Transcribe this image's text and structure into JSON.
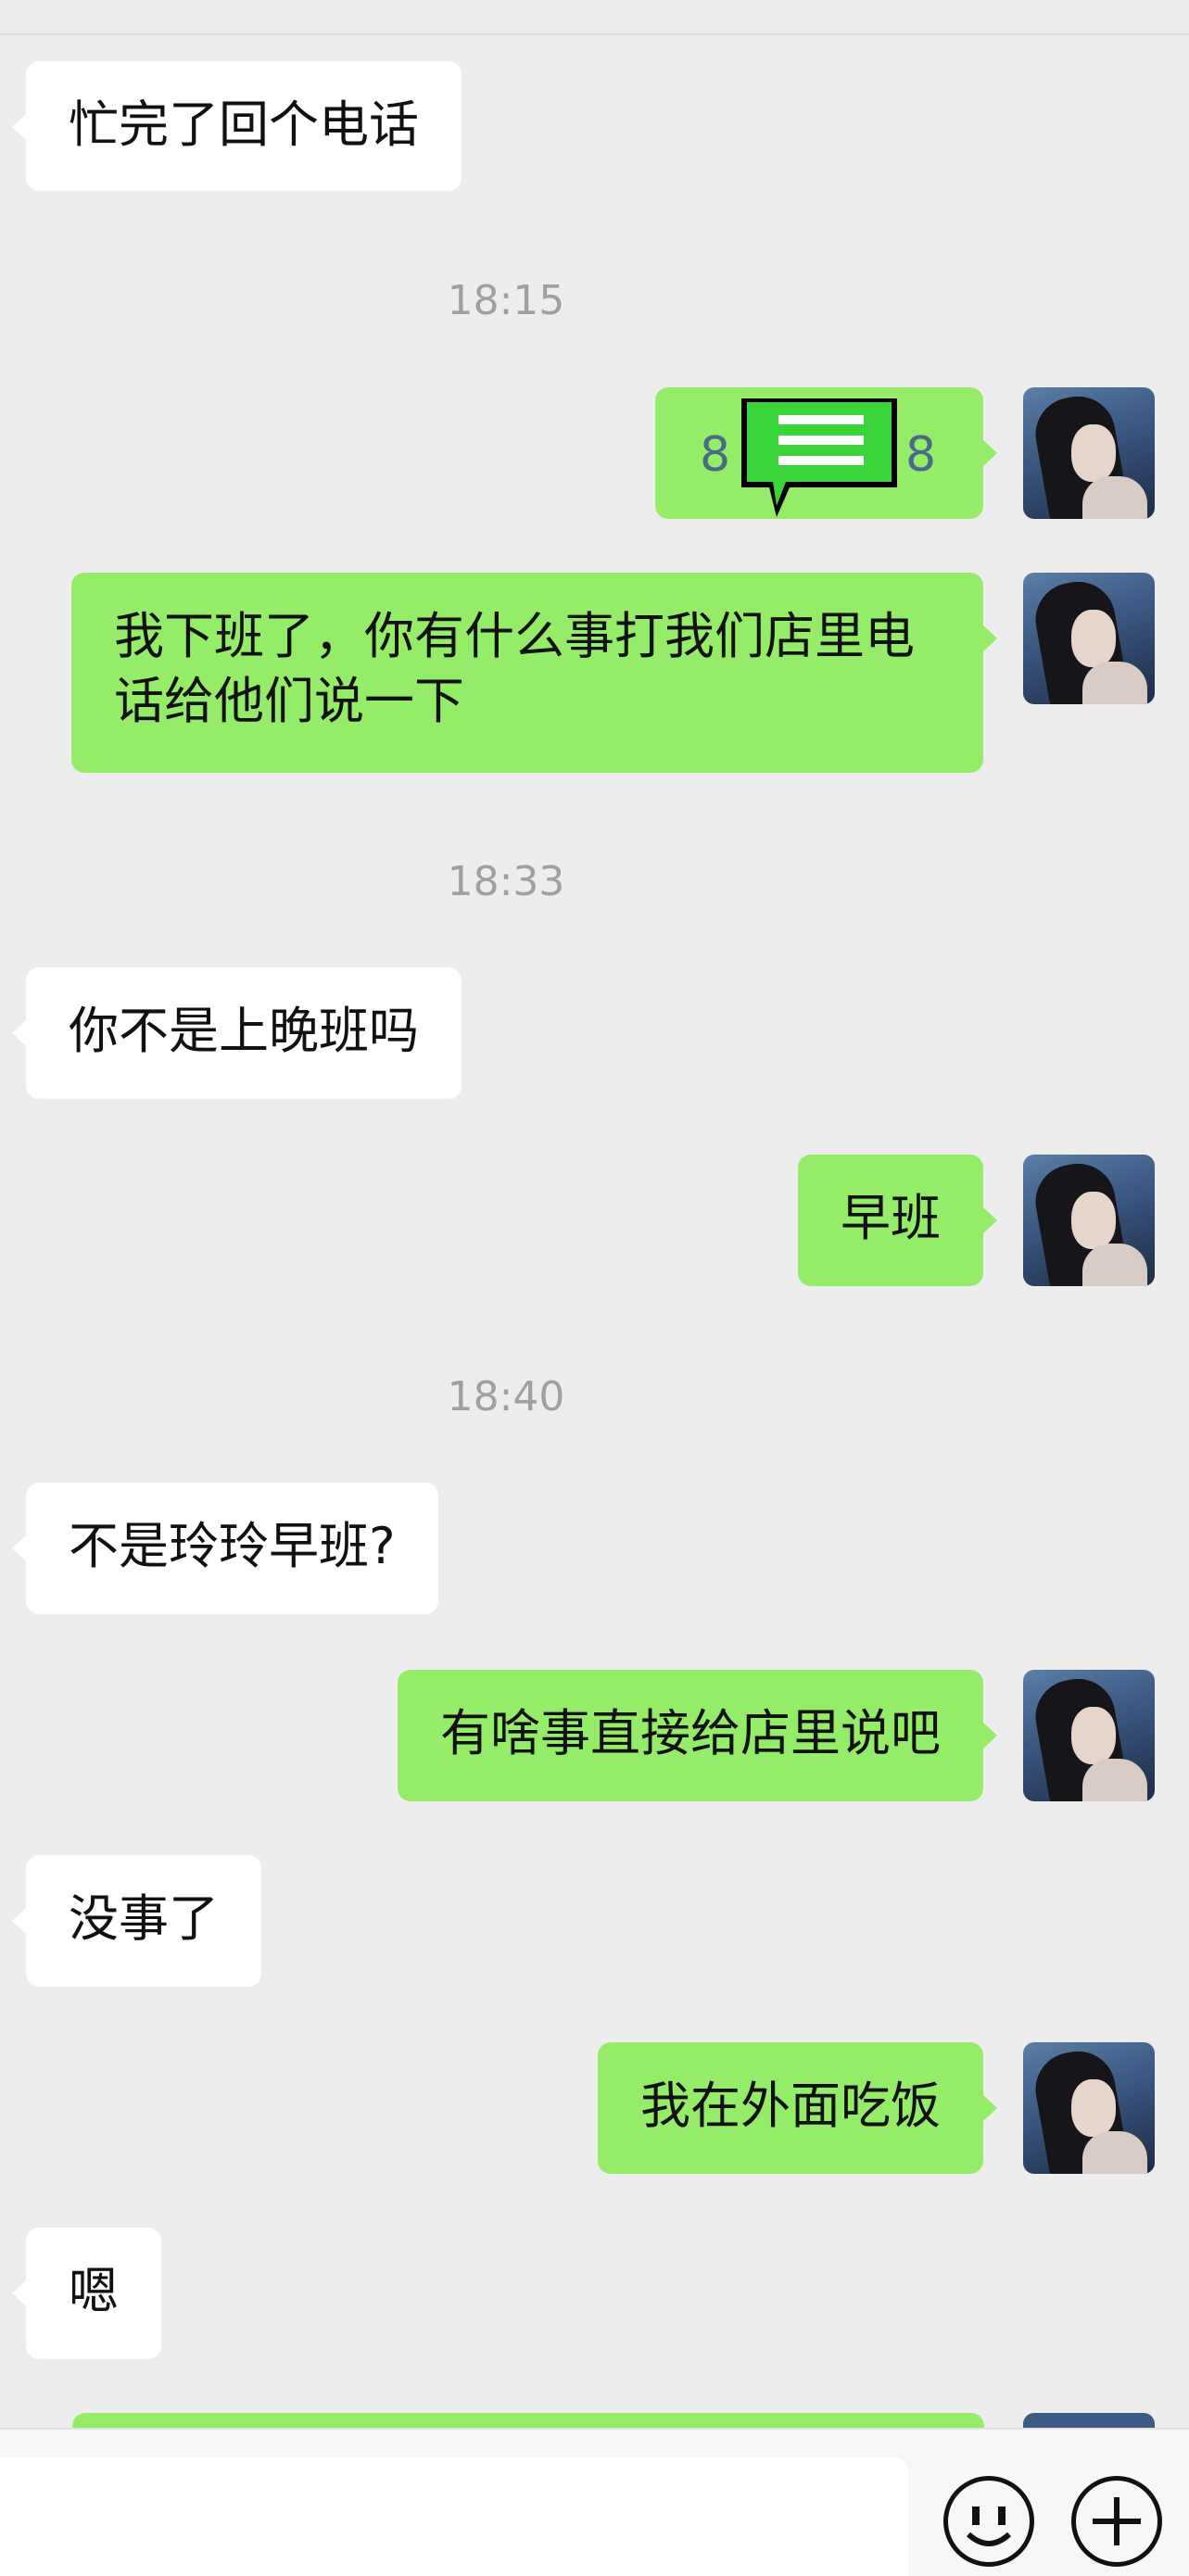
{
  "messages": [
    {
      "side": "in",
      "text": "忙完了回个电话"
    },
    {
      "time": "18:15"
    },
    {
      "side": "out",
      "text": "8"
    },
    {
      "side": "out",
      "text": "我下班了，你有什么事打我们店里电话给他们说一下"
    },
    {
      "time": "18:33"
    },
    {
      "side": "in",
      "text": "你不是上晚班吗"
    },
    {
      "side": "out",
      "text": "早班"
    },
    {
      "time": "18:40"
    },
    {
      "side": "in",
      "text": "不是玲玲早班?"
    },
    {
      "side": "out",
      "text": "有啥事直接给店里说吧"
    },
    {
      "side": "in",
      "text": "没事了"
    },
    {
      "side": "out",
      "text": "我在外面吃饭"
    },
    {
      "side": "in",
      "text": "嗯"
    }
  ],
  "voice_digit_right": "8",
  "colors": {
    "outgoing": "#95ec69",
    "incoming": "#ffffff",
    "background": "#ededed"
  },
  "icons": [
    "emoji-icon",
    "plus-icon",
    "message-sticker-icon"
  ]
}
